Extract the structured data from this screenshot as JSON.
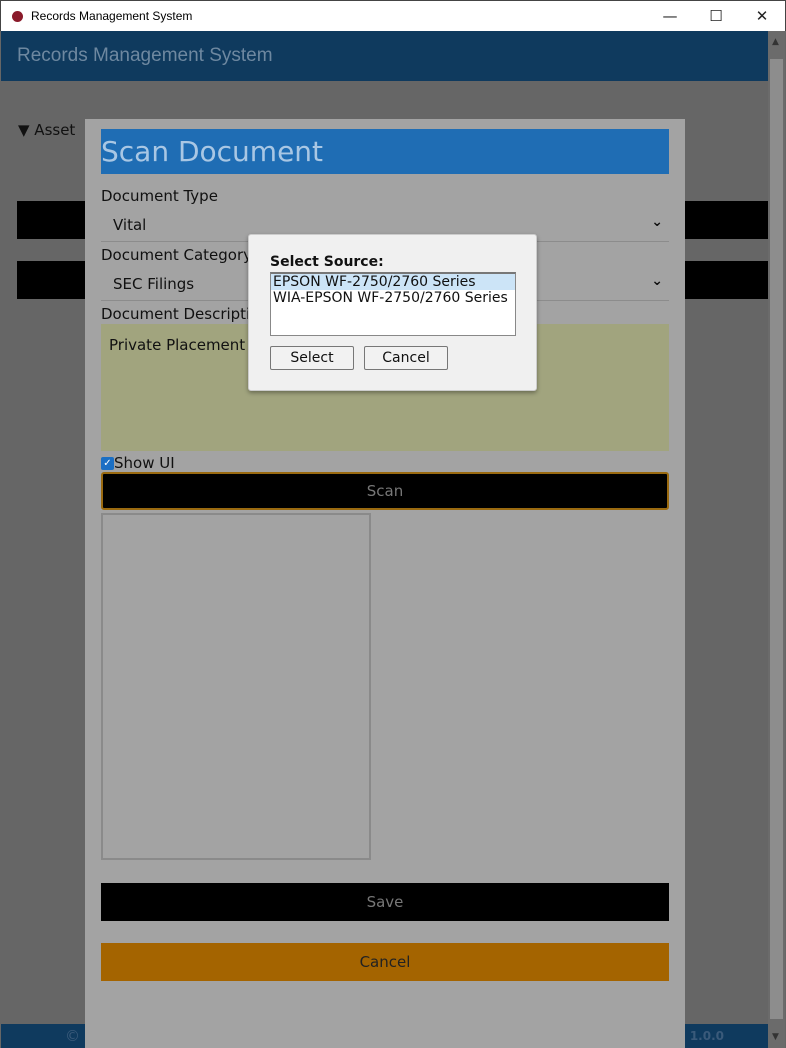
{
  "window": {
    "title": "Records Management System",
    "minimize": "—",
    "maximize": "☐",
    "close": "✕"
  },
  "app": {
    "header": "Records Management System",
    "asset_section": "▼ Asset",
    "footer_copyright": "©",
    "footer_version": "Version 1.0.0"
  },
  "scan_modal": {
    "title": "Scan Document",
    "document_type_label": "Document Type",
    "document_type_value": "Vital",
    "document_category_label": "Document Category",
    "document_category_value": "SEC Filings",
    "document_description_label": "Document Description",
    "document_description_value": "Private Placement",
    "show_ui_label": "Show UI",
    "show_ui_checked": true,
    "scan_label": "Scan",
    "save_label": "Save",
    "cancel_label": "Cancel",
    "chevron": "⌄"
  },
  "source_dialog": {
    "title": "Select Source:",
    "sources": [
      "EPSON WF-2750/2760 Series",
      "WIA-EPSON WF-2750/2760 Series"
    ],
    "selected_index": 0,
    "select_label": "Select",
    "cancel_label": "Cancel"
  },
  "colors": {
    "header": "#0f3a5e",
    "modal_title": "#1f6db4",
    "cancel": "#a46400",
    "selection": "#cce4f7"
  }
}
